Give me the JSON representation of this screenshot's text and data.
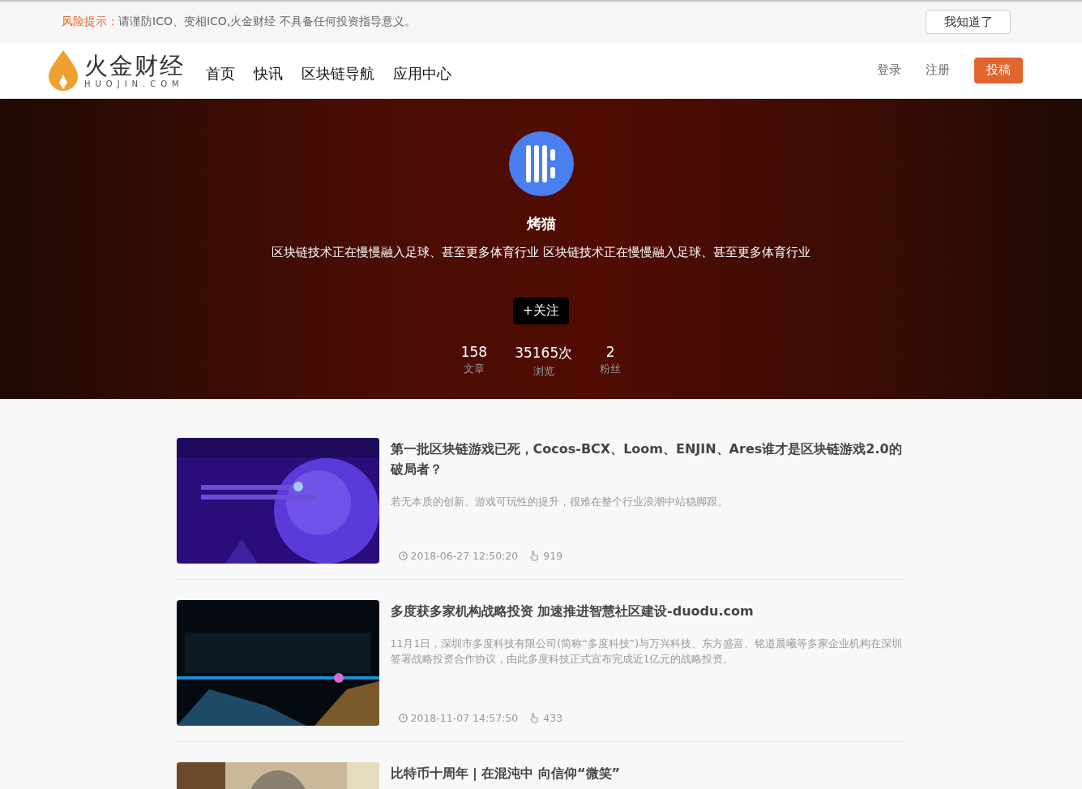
{
  "notice": {
    "label": "风险提示：",
    "text": "请谨防ICO、变相ICO,火金财经 不具备任何投资指导意义。",
    "button": "我知道了"
  },
  "header": {
    "logo": {
      "name": "火金财经",
      "domain": "HUOJIN.COM"
    },
    "nav": [
      {
        "label": "首页"
      },
      {
        "label": "快讯"
      },
      {
        "label": "区块链导航"
      },
      {
        "label": "应用中心"
      }
    ],
    "login": "登录",
    "register": "注册",
    "submit": "投稿"
  },
  "profile": {
    "name": "烤猫",
    "bio": "区块链技术正在慢慢融入足球、甚至更多体育行业 区块链技术正在慢慢融入足球、甚至更多体育行业",
    "follow": "+关注",
    "stats": [
      {
        "value": "158",
        "label": "文章"
      },
      {
        "value": "35165次",
        "label": "浏览"
      },
      {
        "value": "2",
        "label": "粉丝"
      }
    ]
  },
  "articles": [
    {
      "title": "第一批区块链游戏已死，Cocos-BCX、Loom、ENJIN、Ares谁才是区块链游戏2.0的破局者？",
      "summary": "若无本质的创新、游戏可玩性的提升，很难在整个行业浪潮中站稳脚跟。",
      "time": "2018-06-27 12:50:20",
      "likes": "919",
      "kind": "picture"
    },
    {
      "title": "多度获多家机构战略投资 加速推进智慧社区建设-duodu.com",
      "summary": "11月1日，深圳市多度科技有限公司(简称“多度科技”)与万兴科技、东方盛富、铭道晨曦等多家企业机构在深圳签署战略投资合作协议，由此多度科技正式宣布完成近1亿元的战略投资。",
      "time": "2018-11-07 14:57:50",
      "likes": "433",
      "kind": "picture"
    },
    {
      "title": "比特币十周年 | 在混沌中 向信仰“微笑”",
      "kind": "picture"
    }
  ]
}
